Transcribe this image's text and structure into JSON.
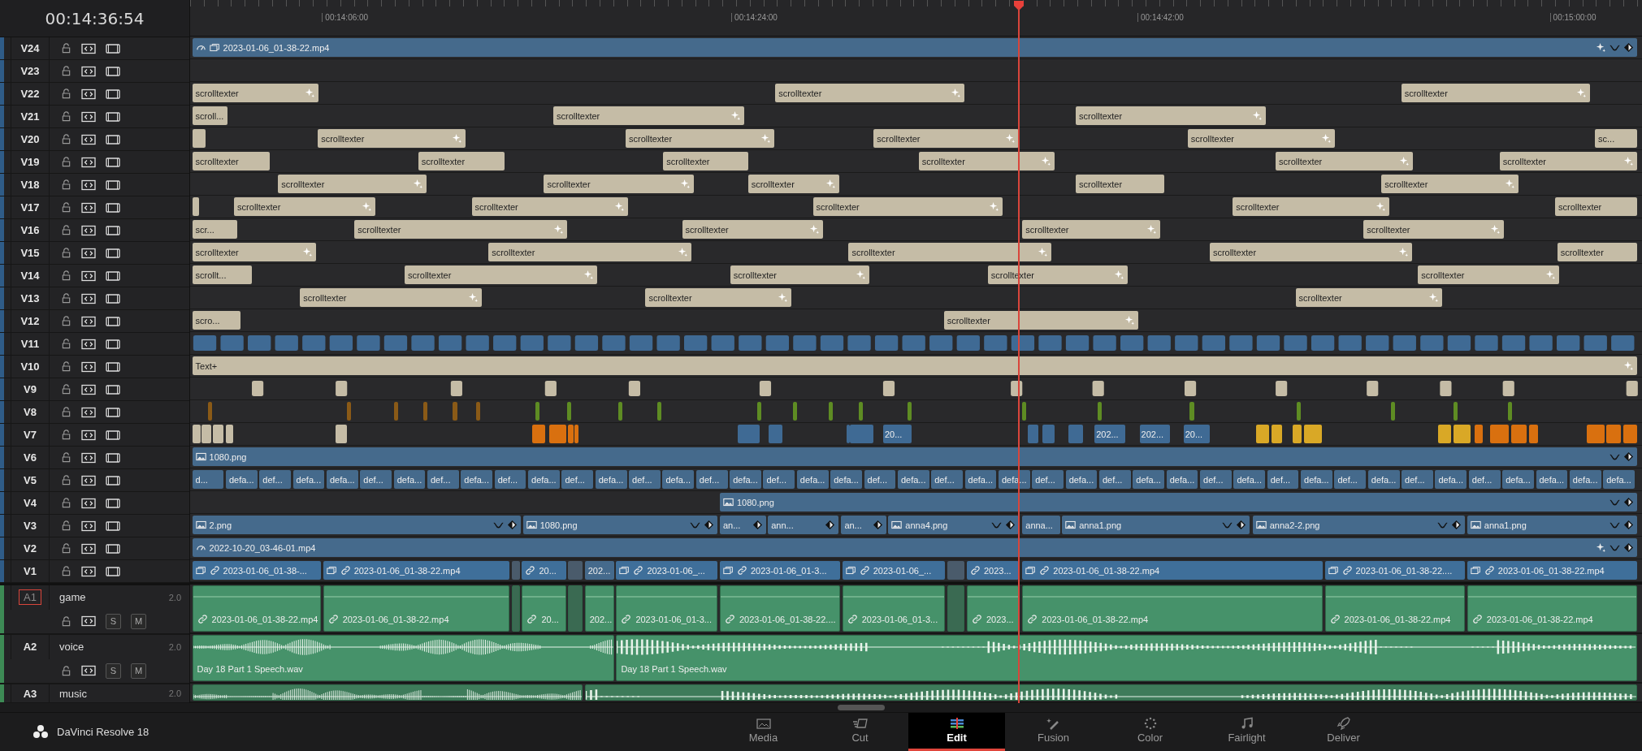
{
  "timecode": "00:14:36:54",
  "ruler": {
    "ticks": [
      "00:14:06:00",
      "00:14:24:00",
      "00:14:42:00",
      "00:15:00:00"
    ]
  },
  "video_tracks": [
    {
      "name": "V24",
      "clips": [
        {
          "kind": "retimed",
          "label": "2023-01-06_01-38-22.mp4"
        }
      ]
    },
    {
      "name": "V23"
    },
    {
      "name": "V22",
      "clips": [
        {
          "kind": "text",
          "label": "scrolltexter"
        },
        {
          "kind": "text",
          "label": "scrolltexter"
        },
        {
          "kind": "text",
          "label": "scrolltexter"
        }
      ]
    },
    {
      "name": "V21",
      "clips": [
        {
          "kind": "text",
          "label": "scroll..."
        },
        {
          "kind": "text",
          "label": "scrolltexter"
        },
        {
          "kind": "text",
          "label": "scrolltexter"
        }
      ]
    },
    {
      "name": "V20",
      "clips": [
        {
          "kind": "text"
        },
        {
          "kind": "text",
          "label": "scrolltexter"
        },
        {
          "kind": "text",
          "label": "scrolltexter"
        },
        {
          "kind": "text",
          "label": "scrolltexter"
        },
        {
          "kind": "text",
          "label": "scrolltexter"
        },
        {
          "kind": "text",
          "label": "sc..."
        }
      ]
    },
    {
      "name": "V19",
      "clips": [
        {
          "kind": "text",
          "label": "scrolltexter"
        },
        {
          "kind": "text",
          "label": "scrolltexter"
        },
        {
          "kind": "text",
          "label": "scrolltexter"
        },
        {
          "kind": "text",
          "label": "scrolltexter"
        },
        {
          "kind": "text",
          "label": "scrolltexter"
        },
        {
          "kind": "text",
          "label": "scrolltexter"
        }
      ]
    },
    {
      "name": "V18",
      "clips": [
        {
          "kind": "text",
          "label": "scrolltexter"
        },
        {
          "kind": "text",
          "label": "scrolltexter"
        },
        {
          "kind": "text",
          "label": "scrolltexter"
        },
        {
          "kind": "text",
          "label": "scrolltexter"
        },
        {
          "kind": "text",
          "label": "scrolltexter"
        }
      ]
    },
    {
      "name": "V17",
      "clips": [
        {
          "kind": "text"
        },
        {
          "kind": "text",
          "label": "scrolltexter"
        },
        {
          "kind": "text",
          "label": "scrolltexter"
        },
        {
          "kind": "text",
          "label": "scrolltexter"
        },
        {
          "kind": "text",
          "label": "scrolltexter"
        },
        {
          "kind": "text",
          "label": "scrolltexter"
        }
      ]
    },
    {
      "name": "V16",
      "clips": [
        {
          "kind": "text",
          "label": "scr..."
        },
        {
          "kind": "text",
          "label": "scrolltexter"
        },
        {
          "kind": "text",
          "label": "scrolltexter"
        },
        {
          "kind": "text",
          "label": "scrolltexter"
        },
        {
          "kind": "text",
          "label": "scrolltexter"
        }
      ]
    },
    {
      "name": "V15",
      "clips": [
        {
          "kind": "text",
          "label": "scrolltexter"
        },
        {
          "kind": "text",
          "label": "scrolltexter"
        },
        {
          "kind": "text",
          "label": "scrolltexter"
        },
        {
          "kind": "text",
          "label": "scrolltexter"
        },
        {
          "kind": "text",
          "label": "scrolltexter"
        }
      ]
    },
    {
      "name": "V14",
      "clips": [
        {
          "kind": "text",
          "label": "scrollt..."
        },
        {
          "kind": "text",
          "label": "scrolltexter"
        },
        {
          "kind": "text",
          "label": "scrolltexter"
        },
        {
          "kind": "text",
          "label": "scrolltexter"
        },
        {
          "kind": "text",
          "label": "scrolltexter"
        }
      ]
    },
    {
      "name": "V13",
      "clips": [
        {
          "kind": "text",
          "label": "scrolltexter"
        },
        {
          "kind": "text",
          "label": "scrolltexter"
        },
        {
          "kind": "text",
          "label": "scrolltexter"
        }
      ]
    },
    {
      "name": "V12",
      "clips": [
        {
          "kind": "text",
          "label": "scro..."
        },
        {
          "kind": "text",
          "label": "scrolltexter"
        }
      ]
    },
    {
      "name": "V11"
    },
    {
      "name": "V10",
      "clips": [
        {
          "kind": "text",
          "label": "Text+"
        }
      ]
    },
    {
      "name": "V9"
    },
    {
      "name": "V8",
      "clips": [
        {
          "kind": "block",
          "color": "#8a5a17"
        },
        {
          "kind": "block",
          "color": "#8a5a17"
        },
        {
          "kind": "block",
          "color": "#8a5a17"
        },
        {
          "kind": "block",
          "color": "#8a5a17"
        },
        {
          "kind": "block",
          "color": "#8a5a17"
        },
        {
          "kind": "block",
          "color": "#8a5a17"
        },
        {
          "kind": "block",
          "color": "#5e8c23"
        },
        {
          "kind": "block",
          "color": "#5e8c23"
        },
        {
          "kind": "block",
          "color": "#5e8c23"
        },
        {
          "kind": "block",
          "color": "#5e8c23"
        },
        {
          "kind": "block",
          "color": "#5e8c23"
        },
        {
          "kind": "block",
          "color": "#5e8c23"
        },
        {
          "kind": "block",
          "color": "#5e8c23"
        },
        {
          "kind": "block",
          "color": "#5e8c23"
        },
        {
          "kind": "block",
          "color": "#5e8c23"
        },
        {
          "kind": "block",
          "color": "#5e8c23"
        },
        {
          "kind": "block",
          "color": "#5e8c23"
        },
        {
          "kind": "block",
          "color": "#5e8c23"
        },
        {
          "kind": "block",
          "color": "#5e8c23"
        },
        {
          "kind": "block",
          "color": "#5e8c23"
        },
        {
          "kind": "block",
          "color": "#5e8c23"
        },
        {
          "kind": "block",
          "color": "#5e8c23"
        }
      ]
    },
    {
      "name": "V7",
      "clips": [
        {
          "kind": "block",
          "color": "#c5bca6"
        },
        {
          "kind": "block",
          "color": "#c5bca6"
        },
        {
          "kind": "block",
          "color": "#c5bca6"
        },
        {
          "kind": "block",
          "color": "#c5bca6"
        },
        {
          "kind": "block",
          "color": "#c5bca6"
        },
        {
          "kind": "block",
          "color": "#d9700f"
        },
        {
          "kind": "block",
          "color": "#d9700f"
        },
        {
          "kind": "block",
          "color": "#d9700f"
        },
        {
          "kind": "block",
          "color": "#d9700f"
        },
        {
          "kind": "block",
          "color": "#3f6a94"
        },
        {
          "kind": "block",
          "color": "#3f6a94"
        },
        {
          "kind": "block",
          "color": "#3f6a94"
        },
        {
          "kind": "block",
          "color": "#3f6a94"
        },
        {
          "kind": "block",
          "color": "#3f6a94",
          "label": "20..."
        },
        {
          "kind": "block",
          "color": "#3f6a94"
        },
        {
          "kind": "block",
          "color": "#3f6a94"
        },
        {
          "kind": "block",
          "color": "#3f6a94"
        },
        {
          "kind": "block",
          "color": "#3f6a94",
          "label": "202..."
        },
        {
          "kind": "block",
          "color": "#3f6a94",
          "label": "202..."
        },
        {
          "kind": "block",
          "color": "#3f6a94",
          "label": "20..."
        },
        {
          "kind": "block",
          "color": "#d9a826"
        },
        {
          "kind": "block",
          "color": "#d9a826"
        },
        {
          "kind": "block",
          "color": "#d9a826"
        },
        {
          "kind": "block",
          "color": "#d9a826"
        },
        {
          "kind": "block",
          "color": "#d9a826"
        },
        {
          "kind": "block",
          "color": "#d9a826"
        },
        {
          "kind": "block",
          "color": "#d9700f"
        },
        {
          "kind": "block",
          "color": "#d9700f"
        },
        {
          "kind": "block",
          "color": "#d9700f"
        },
        {
          "kind": "block",
          "color": "#d9700f"
        },
        {
          "kind": "block",
          "color": "#d9700f"
        },
        {
          "kind": "block",
          "color": "#d9700f"
        },
        {
          "kind": "block",
          "color": "#d9700f"
        }
      ]
    },
    {
      "name": "V6",
      "clips": [
        {
          "kind": "image",
          "label": "1080.png"
        }
      ]
    },
    {
      "name": "V5",
      "clips": [
        {
          "kind": "compound",
          "label": "d..."
        },
        {
          "kind": "compound",
          "label": "defa..."
        },
        {
          "kind": "compound",
          "label": "def..."
        },
        {
          "kind": "compound",
          "label": "defa..."
        },
        {
          "kind": "compound",
          "label": "defa..."
        },
        {
          "kind": "compound",
          "label": "def..."
        },
        {
          "kind": "compound",
          "label": "defa..."
        },
        {
          "kind": "compound",
          "label": "def..."
        },
        {
          "kind": "compound",
          "label": "defa..."
        },
        {
          "kind": "compound",
          "label": "def..."
        },
        {
          "kind": "compound",
          "label": "defa..."
        },
        {
          "kind": "compound",
          "label": "def..."
        },
        {
          "kind": "compound",
          "label": "defa..."
        },
        {
          "kind": "compound",
          "label": "def..."
        },
        {
          "kind": "compound",
          "label": "defa..."
        },
        {
          "kind": "compound",
          "label": "def..."
        },
        {
          "kind": "compound",
          "label": "defa..."
        },
        {
          "kind": "compound",
          "label": "def..."
        },
        {
          "kind": "compound",
          "label": "defa..."
        },
        {
          "kind": "compound",
          "label": "defa..."
        },
        {
          "kind": "compound",
          "label": "def..."
        },
        {
          "kind": "compound",
          "label": "defa..."
        },
        {
          "kind": "compound",
          "label": "def..."
        },
        {
          "kind": "compound",
          "label": "defa..."
        },
        {
          "kind": "compound",
          "label": "defa..."
        },
        {
          "kind": "compound",
          "label": "def..."
        },
        {
          "kind": "compound",
          "label": "defa..."
        },
        {
          "kind": "compound",
          "label": "def..."
        },
        {
          "kind": "compound",
          "label": "defa..."
        },
        {
          "kind": "compound",
          "label": "defa..."
        },
        {
          "kind": "compound",
          "label": "def..."
        },
        {
          "kind": "compound",
          "label": "defa..."
        },
        {
          "kind": "compound",
          "label": "def..."
        },
        {
          "kind": "compound",
          "label": "defa..."
        },
        {
          "kind": "compound",
          "label": "def..."
        },
        {
          "kind": "compound",
          "label": "defa..."
        },
        {
          "kind": "compound",
          "label": "def..."
        },
        {
          "kind": "compound",
          "label": "defa..."
        },
        {
          "kind": "compound",
          "label": "def..."
        },
        {
          "kind": "compound",
          "label": "defa..."
        },
        {
          "kind": "compound",
          "label": "defa..."
        },
        {
          "kind": "compound",
          "label": "defa..."
        },
        {
          "kind": "compound",
          "label": "defa..."
        }
      ]
    },
    {
      "name": "V4",
      "clips": [
        {
          "kind": "image",
          "label": "1080.png"
        }
      ]
    },
    {
      "name": "V3",
      "clips": [
        {
          "kind": "image",
          "label": "2.png"
        },
        {
          "kind": "image",
          "label": "1080.png"
        },
        {
          "kind": "plain",
          "label": "an..."
        },
        {
          "kind": "plain",
          "label": "ann..."
        },
        {
          "kind": "plain",
          "label": "an..."
        },
        {
          "kind": "image",
          "label": "anna4.png"
        },
        {
          "kind": "plain",
          "label": "anna..."
        },
        {
          "kind": "image",
          "label": "anna1.png"
        },
        {
          "kind": "image",
          "label": "anna2-2.png"
        },
        {
          "kind": "image",
          "label": "anna1.png"
        }
      ]
    },
    {
      "name": "V2",
      "clips": [
        {
          "kind": "retimed",
          "label": "2022-10-20_03-46-01.mp4"
        }
      ]
    },
    {
      "name": "V1",
      "clips": [
        {
          "kind": "linked",
          "stacked": true,
          "label": "2023-01-06_01-38-..."
        },
        {
          "kind": "linked",
          "stacked": true,
          "label": "2023-01-06_01-38-22.mp4"
        },
        {
          "kind": "gap"
        },
        {
          "kind": "linked",
          "stacked": false,
          "label": "20..."
        },
        {
          "kind": "gap"
        },
        {
          "kind": "plain",
          "label": "202..."
        },
        {
          "kind": "linked",
          "stacked": true,
          "label": "2023-01-06_..."
        },
        {
          "kind": "linked",
          "stacked": true,
          "label": "2023-01-06_01-3..."
        },
        {
          "kind": "linked",
          "stacked": true,
          "label": "2023-01-06_..."
        },
        {
          "kind": "gap"
        },
        {
          "kind": "linked",
          "stacked": false,
          "label": "2023..."
        },
        {
          "kind": "linked",
          "stacked": true,
          "label": "2023-01-06_01-38-22.mp4"
        },
        {
          "kind": "linked",
          "stacked": true,
          "label": "2023-01-06_01-38-22...."
        },
        {
          "kind": "linked",
          "stacked": true,
          "label": "2023-01-06_01-38-22.mp4"
        }
      ]
    }
  ],
  "audio_tracks": [
    {
      "name": "A1",
      "selected": true,
      "title": "game",
      "format": "2.0",
      "solo": "S",
      "mute": "M",
      "clips": [
        {
          "kind": "linked",
          "label": "2023-01-06_01-38-22.mp4"
        },
        {
          "kind": "linked",
          "label": "2023-01-06_01-38-22.mp4"
        },
        {
          "kind": "gap"
        },
        {
          "kind": "linked",
          "label": "20..."
        },
        {
          "kind": "gap"
        },
        {
          "kind": "plain",
          "label": "202..."
        },
        {
          "kind": "linked",
          "label": "2023-01-06_01-3..."
        },
        {
          "kind": "linked",
          "label": "2023-01-06_01-38-22...."
        },
        {
          "kind": "linked",
          "label": "2023-01-06_01-3..."
        },
        {
          "kind": "gap"
        },
        {
          "kind": "linked",
          "label": "2023..."
        },
        {
          "kind": "linked",
          "label": "2023-01-06_01-38-22.mp4"
        },
        {
          "kind": "linked",
          "label": "2023-01-06_01-38-22.mp4"
        },
        {
          "kind": "linked",
          "label": "2023-01-06_01-38-22.mp4"
        }
      ]
    },
    {
      "name": "A2",
      "selected": false,
      "title": "voice",
      "format": "2.0",
      "solo": "S",
      "mute": "M",
      "clips": [
        {
          "kind": "wave",
          "label": "Day 18 Part 1 Speech.wav"
        },
        {
          "kind": "wave",
          "label": "Day 18 Part 1 Speech.wav"
        }
      ]
    },
    {
      "name": "A3",
      "selected": false,
      "title": "music",
      "format": "2.0",
      "clips": [
        {
          "kind": "wave"
        },
        {
          "kind": "wave"
        }
      ]
    }
  ],
  "app": {
    "name": "DaVinci Resolve 18"
  },
  "pages": [
    {
      "label": "Media",
      "selected": false
    },
    {
      "label": "Cut",
      "selected": false
    },
    {
      "label": "Edit",
      "selected": true
    },
    {
      "label": "Fusion",
      "selected": false
    },
    {
      "label": "Color",
      "selected": false
    },
    {
      "label": "Fairlight",
      "selected": false
    },
    {
      "label": "Deliver",
      "selected": false
    }
  ]
}
